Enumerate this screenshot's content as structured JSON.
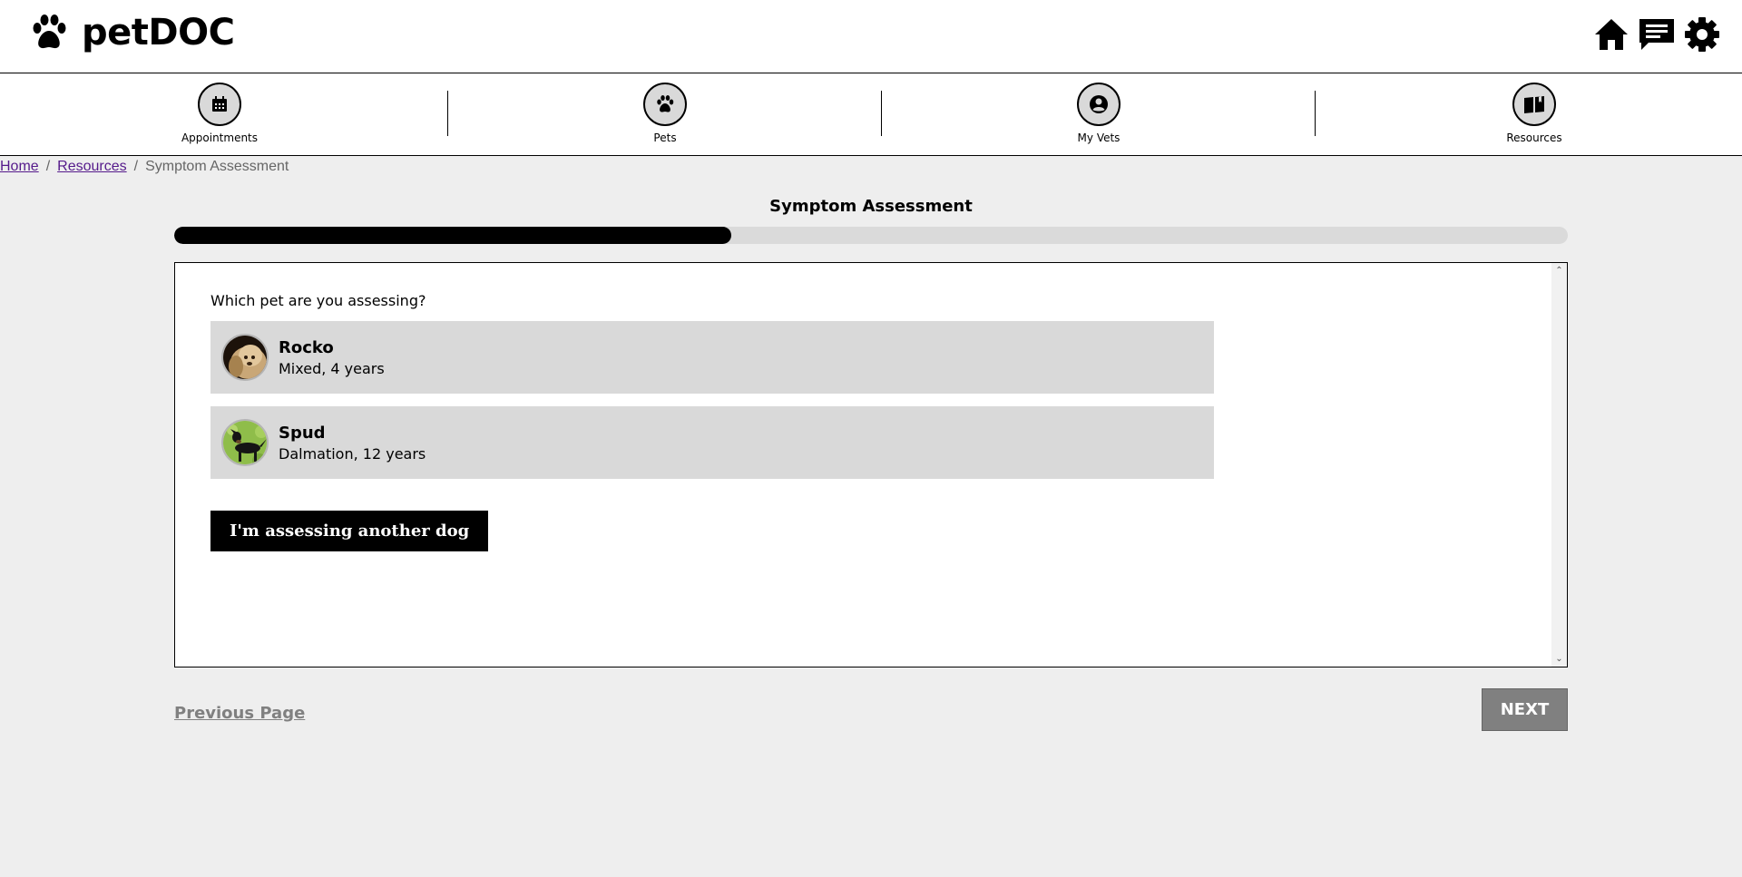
{
  "app": {
    "name": "petDOC"
  },
  "header_icons": [
    "home-icon",
    "messages-icon",
    "settings-icon"
  ],
  "nav": {
    "items": [
      {
        "label": "Appointments",
        "icon": "calendar-icon"
      },
      {
        "label": "Pets",
        "icon": "paw-icon"
      },
      {
        "label": "My Vets",
        "icon": "user-circle-icon"
      },
      {
        "label": "Resources",
        "icon": "book-icon"
      }
    ]
  },
  "breadcrumb": {
    "home": "Home",
    "resources": "Resources",
    "current": "Symptom Assessment",
    "separator": "/"
  },
  "page": {
    "title": "Symptom Assessment",
    "progress_percent": 40
  },
  "assessment": {
    "question": "Which pet are you assessing?",
    "pets": [
      {
        "name": "Rocko",
        "description": "Mixed, 4 years"
      },
      {
        "name": "Spud",
        "description": "Dalmation, 12 years"
      }
    ],
    "another_button": "I'm assessing another dog"
  },
  "footer": {
    "previous": "Previous Page",
    "next": "NEXT"
  },
  "colors": {
    "nav_circle": "#d9d9d9",
    "card": "#d9d9d9",
    "next_bg": "#808080",
    "progress_fill": "#000000",
    "progress_track": "#dadada"
  }
}
